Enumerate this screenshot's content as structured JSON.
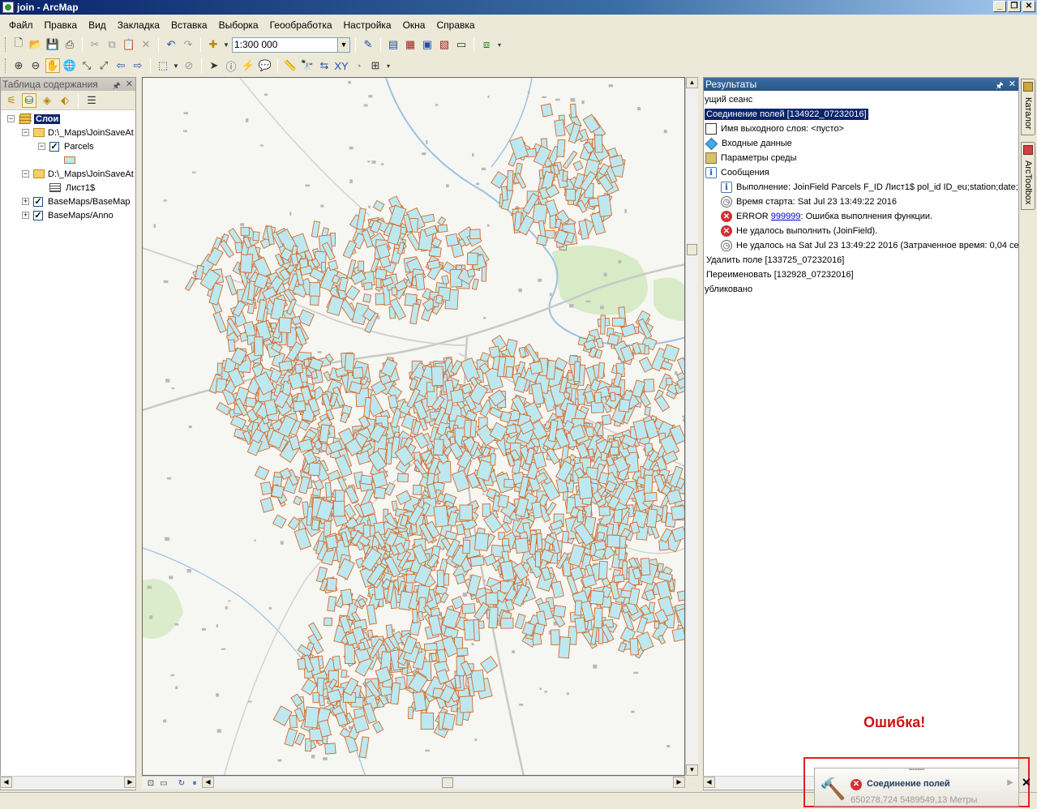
{
  "window": {
    "title": "join - ArcMap"
  },
  "menu": [
    "Файл",
    "Правка",
    "Вид",
    "Закладка",
    "Вставка",
    "Выборка",
    "Геообработка",
    "Настройка",
    "Окна",
    "Справка"
  ],
  "toolbar": {
    "scale": "1:300 000"
  },
  "toc": {
    "title": "Таблица содержания",
    "root_label": "Слои",
    "items": [
      {
        "label": "D:\\_Maps\\JoinSaveAt"
      },
      {
        "label": "Parcels"
      },
      {
        "label": "D:\\_Maps\\JoinSaveAt"
      },
      {
        "label": "Лист1$"
      },
      {
        "label": "BaseMaps/BaseMap"
      },
      {
        "label": "BaseMaps/Anno"
      }
    ]
  },
  "results": {
    "title": "Результаты",
    "session": "ущий сеанс",
    "tool_title": "Соединение полей [134922_07232016]",
    "output_layer": "Имя выходного слоя: <пусто>",
    "inputs": "Входные данные",
    "env": "Параметры среды",
    "messages": "Сообщения",
    "msg_exec": "Выполнение: JoinField Parcels F_ID Лист1$ pol_id ID_eu;station;date;s",
    "msg_start": "Время старта: Sat Jul 23 13:49:22 2016",
    "msg_error_prefix": "ERROR ",
    "msg_error_code": "999999",
    "msg_error_text": ": Ошибка выполнения функции.",
    "msg_fail": "Не удалось выполнить (JoinField).",
    "msg_fail_time": "Не удалось на Sat Jul 23 13:49:22 2016 (Затраченное время: 0,04 се",
    "delete_field": "Удалить поле [133725_07232016]",
    "rename": "Переименовать [132928_07232016]",
    "published": "убликовано"
  },
  "side_tabs": {
    "catalog": "Каталог",
    "toolbox": "ArcToolbox"
  },
  "annotation": {
    "error": "Ошибка!"
  },
  "notification": {
    "title": "Соединение полей",
    "coords": "650278,724  5489549,13 Метры"
  },
  "colors": {
    "parcel_fill": "#bee8f0",
    "parcel_outline": "#d46a2a",
    "highlight": "#0a246a",
    "error": "#d01010"
  }
}
